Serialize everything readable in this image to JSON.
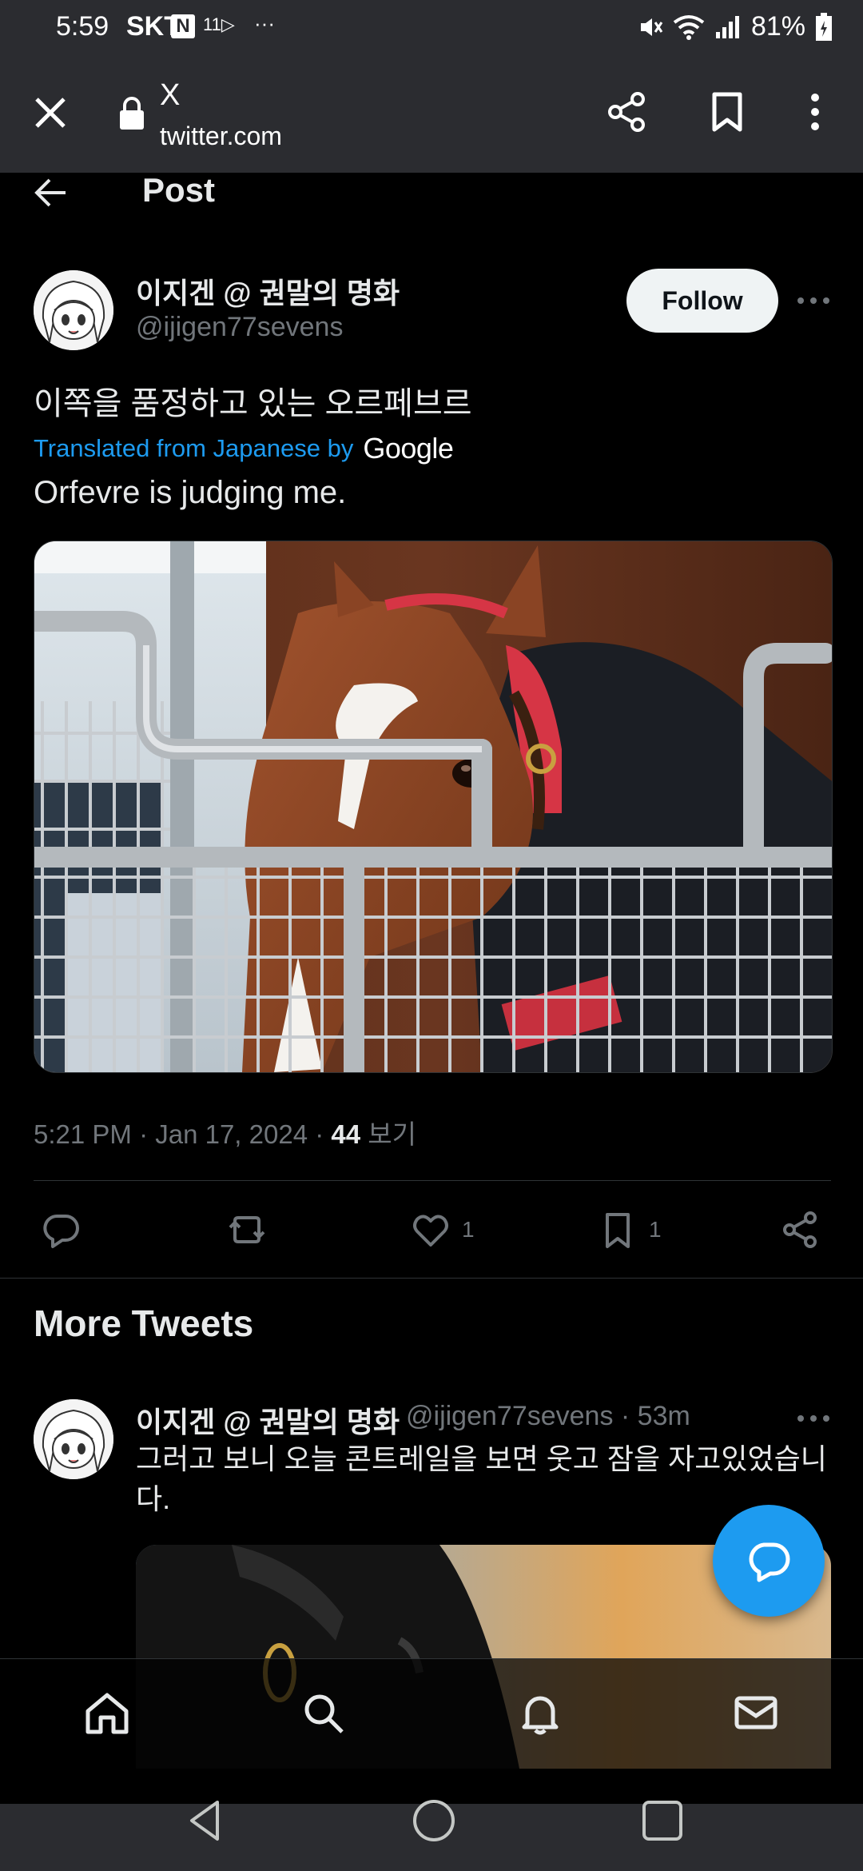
{
  "status_bar": {
    "time": "5:59",
    "carrier": "SKT",
    "n_badge": "N",
    "network_small": "11▷",
    "dots": "···",
    "battery": "81%"
  },
  "browser": {
    "page_title": "X",
    "url": "twitter.com"
  },
  "post_header": {
    "title": "Post"
  },
  "tweet": {
    "display_name": "이지겐 @ 권말의 명화",
    "handle": "@ijigen77sevens",
    "follow_label": "Follow",
    "text": "이쪽을 품정하고 있는 오르페브르",
    "translated_label": "Translated from Japanese by",
    "translator": "Google",
    "translation": "Orfevre is judging me.",
    "time": "5:21 PM · Jan 17, 2024 · ",
    "views_count": "44",
    "views_label": " 보기",
    "likes": "1",
    "bookmarks": "1"
  },
  "more_tweets": {
    "title": "More Tweets",
    "item": {
      "display_name": "이지겐 @ 권말의 명화",
      "handle_time": "@ijigen77sevens · 53m",
      "text": "그러고 보니 오늘 콘트레일을 보면 웃고 잠을 자고있었습니다."
    }
  },
  "icons": {
    "more": "more-horizontal-icon",
    "reply": "reply-icon",
    "retweet": "retweet-icon",
    "like": "heart-icon",
    "bookmark": "bookmark-icon",
    "share": "share-icon"
  },
  "colors": {
    "accent": "#1d9bf0",
    "background": "#000000",
    "chrome": "#2b2c30"
  }
}
